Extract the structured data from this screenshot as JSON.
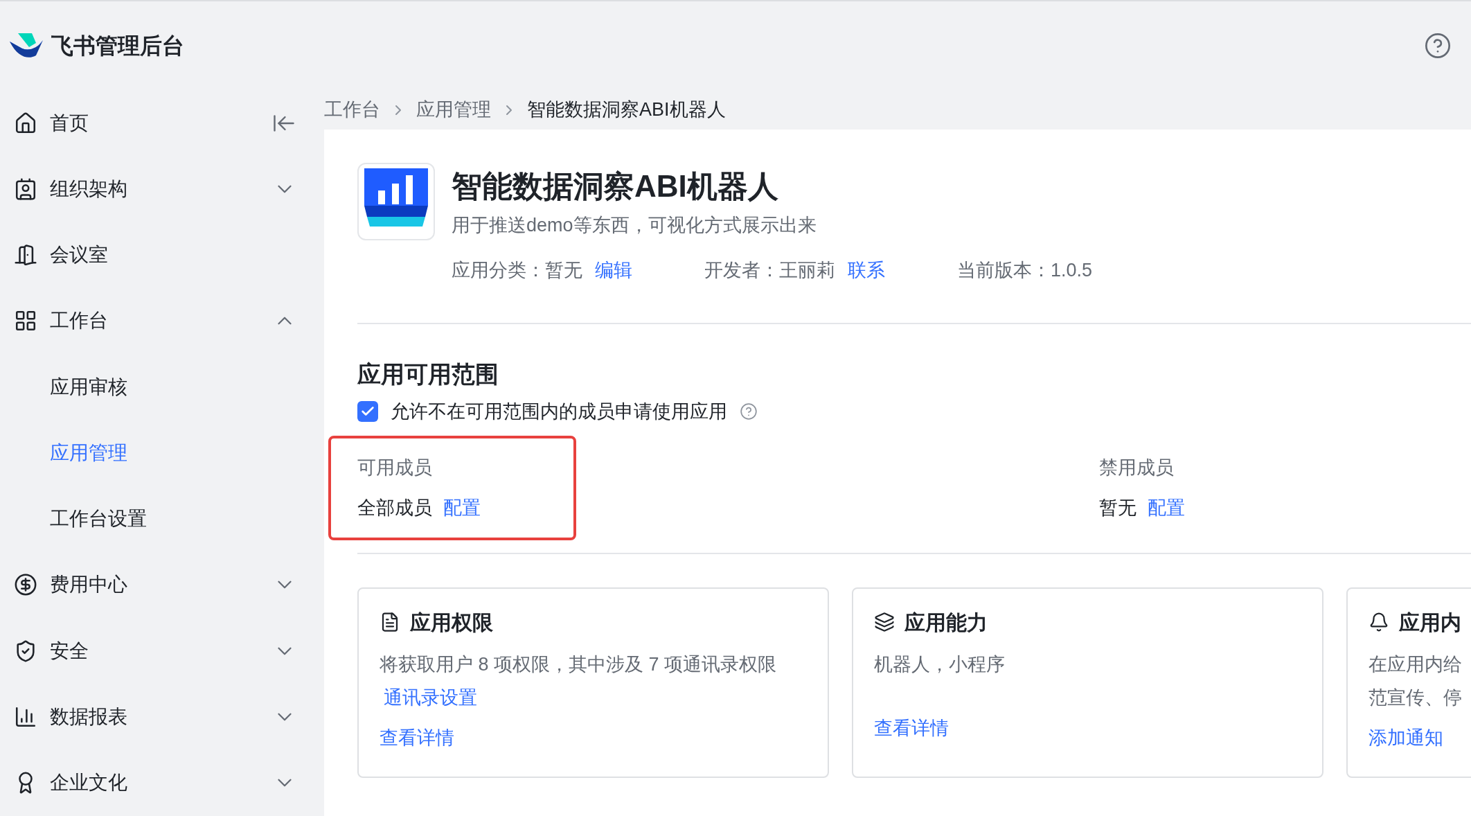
{
  "header": {
    "title": "飞书管理后台"
  },
  "sidebar": {
    "items": [
      {
        "label": "首页"
      },
      {
        "label": "组织架构",
        "expanded": false
      },
      {
        "label": "会议室"
      },
      {
        "label": "工作台",
        "expanded": true,
        "children": [
          {
            "label": "应用审核",
            "selected": false
          },
          {
            "label": "应用管理",
            "selected": true
          },
          {
            "label": "工作台设置",
            "selected": false
          }
        ]
      },
      {
        "label": "费用中心",
        "expanded": false
      },
      {
        "label": "安全",
        "expanded": false
      },
      {
        "label": "数据报表",
        "expanded": false
      },
      {
        "label": "企业文化",
        "expanded": false
      }
    ]
  },
  "breadcrumb": [
    "工作台",
    "应用管理",
    "智能数据洞察ABI机器人"
  ],
  "app": {
    "name": "智能数据洞察ABI机器人",
    "description": "用于推送demo等东西，可视化方式展示出来",
    "meta": [
      {
        "label": "应用分类：",
        "value": "暂无",
        "link": "编辑"
      },
      {
        "label": "开发者：",
        "value": "王丽莉",
        "link": "联系"
      },
      {
        "label": "当前版本：",
        "value": "1.0.5"
      }
    ]
  },
  "scope": {
    "title": "应用可用范围",
    "checkbox": {
      "label": "允许不在可用范围内的成员申请使用应用",
      "checked": true
    },
    "columns": [
      {
        "heading": "可用成员",
        "value": "全部成员",
        "link": "配置",
        "highlighted": true
      },
      {
        "heading": "禁用成员",
        "value": "暂无",
        "link": "配置",
        "highlighted": false
      }
    ]
  },
  "cards": [
    {
      "title": "应用权限",
      "lines": [
        "将获取用户 8 项权限，其中涉及 7 项通讯录权限"
      ],
      "link": "通讯录设置",
      "action": "查看详情"
    },
    {
      "title": "应用能力",
      "lines": [
        "机器人，小程序"
      ],
      "action": "查看详情"
    },
    {
      "title": "应用内",
      "lines": [
        "在应用内给",
        "范宣传、停"
      ],
      "action": "添加通知"
    }
  ]
}
